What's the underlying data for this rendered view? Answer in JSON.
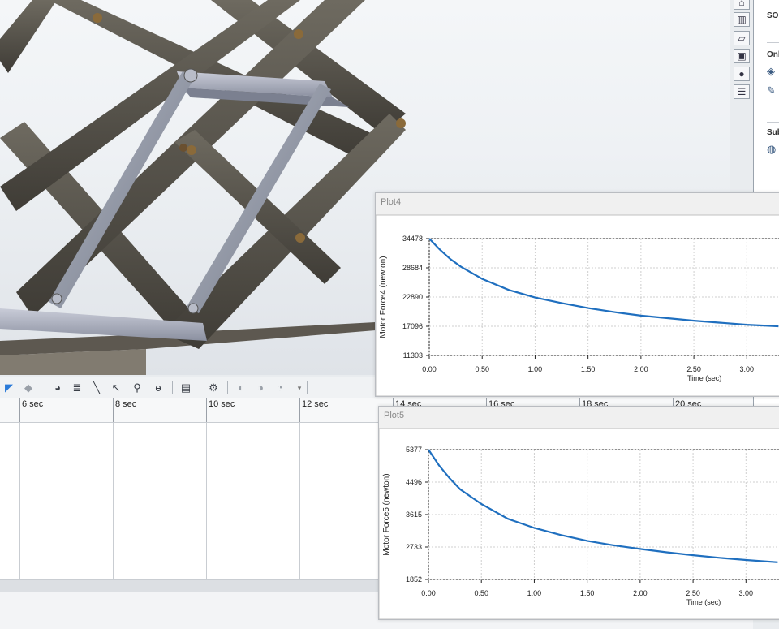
{
  "viewport": {
    "model": "scissor lift assembly"
  },
  "taskpane": {
    "tabs": [
      "home-icon",
      "parts-icon",
      "folder-icon",
      "view-palette-icon",
      "appearance-icon",
      "custom-properties-icon"
    ],
    "section1": "SOL",
    "section2": "Onl",
    "section3": "Sub"
  },
  "toolbar": {
    "tools": [
      "motion-study-icon",
      "animation-wizard-icon",
      "motor-icon",
      "spring-icon",
      "damper-icon",
      "select-icon",
      "contact-icon",
      "gravity-icon",
      "results-plot-icon",
      "motion-study-properties-icon",
      "calculate-icon",
      "simulation-setup-icon",
      "more-dropdown-icon"
    ]
  },
  "timeline": {
    "labels": [
      "6 sec",
      "8 sec",
      "10 sec",
      "12 sec",
      "14 sec",
      "16 sec",
      "18 sec",
      "20 sec"
    ]
  },
  "plots": [
    {
      "title": "Plot4",
      "chart_data": {
        "type": "line",
        "ylabel": "Motor Force4 (newton)",
        "xlabel": "Time (sec)",
        "xticks": [
          "0.00",
          "0.50",
          "1.00",
          "1.50",
          "2.00",
          "2.50",
          "3.00"
        ],
        "yticks": [
          "34478",
          "28684",
          "22890",
          "17096",
          "11303"
        ],
        "ylim": [
          11303,
          34478
        ],
        "series": [
          {
            "color": "#1f6fbf",
            "x": [
              0.0,
              0.1,
              0.2,
              0.3,
              0.5,
              0.75,
              1.0,
              1.25,
              1.5,
              1.75,
              2.0,
              2.25,
              2.5,
              2.75,
              3.0,
              3.3
            ],
            "y": [
              34478,
              32300,
              30400,
              28900,
              26500,
              24300,
              22800,
              21700,
              20700,
              19900,
              19200,
              18700,
              18200,
              17800,
              17400,
              17100
            ]
          }
        ],
        "grid": true
      }
    },
    {
      "title": "Plot5",
      "chart_data": {
        "type": "line",
        "ylabel": "Motor Force5 (newton)",
        "xlabel": "Time (sec)",
        "xticks": [
          "0.00",
          "0.50",
          "1.00",
          "1.50",
          "2.00",
          "2.50",
          "3.00"
        ],
        "yticks": [
          "5377",
          "4496",
          "3615",
          "2733",
          "1852"
        ],
        "ylim": [
          1852,
          5377
        ],
        "series": [
          {
            "color": "#1f6fbf",
            "x": [
              0.0,
              0.1,
              0.2,
              0.3,
              0.5,
              0.75,
              1.0,
              1.25,
              1.5,
              1.75,
              2.0,
              2.25,
              2.5,
              2.75,
              3.0,
              3.3
            ],
            "y": [
              5377,
              4950,
              4600,
              4300,
              3900,
              3500,
              3250,
              3060,
              2900,
              2780,
              2680,
              2590,
              2510,
              2440,
              2380,
              2320
            ]
          }
        ],
        "grid": true
      }
    }
  ]
}
